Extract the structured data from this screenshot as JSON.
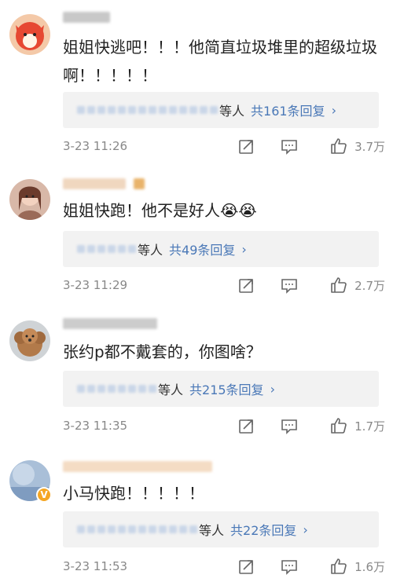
{
  "comments": [
    {
      "text": "姐姐快逃吧！！！他简直垃圾堆里的超级垃圾啊！！！！！",
      "reply_suffix": "等人",
      "reply_count": "共161条回复",
      "reply_chevron": "›",
      "timestamp": "3-23 11:26",
      "likes": "3.7万",
      "avatar": "red-cartoon-avatar"
    },
    {
      "text": "姐姐快跑！他不是好人😭😭",
      "reply_suffix": "等人",
      "reply_count": "共49条回复",
      "reply_chevron": "›",
      "timestamp": "3-23 11:29",
      "likes": "2.7万",
      "avatar": "girl-photo-avatar"
    },
    {
      "text": "张约p都不戴套的，你图啥？",
      "reply_suffix": "等人",
      "reply_count": "共215条回复",
      "reply_chevron": "›",
      "timestamp": "3-23 11:35",
      "likes": "1.7万",
      "avatar": "dog-photo-avatar"
    },
    {
      "text": "小马快跑！！！！！",
      "reply_suffix": "等人",
      "reply_count": "共22条回复",
      "reply_chevron": "›",
      "timestamp": "3-23 11:53",
      "likes": "1.6万",
      "avatar": "blue-photo-avatar",
      "verified_badge": "V"
    }
  ],
  "icons": {
    "forward": "forward-icon",
    "comment": "comment-icon",
    "like": "like-icon"
  },
  "colors": {
    "link_blue": "#4a78b7",
    "meta_gray": "#888888",
    "reply_bg": "#f2f2f2"
  }
}
